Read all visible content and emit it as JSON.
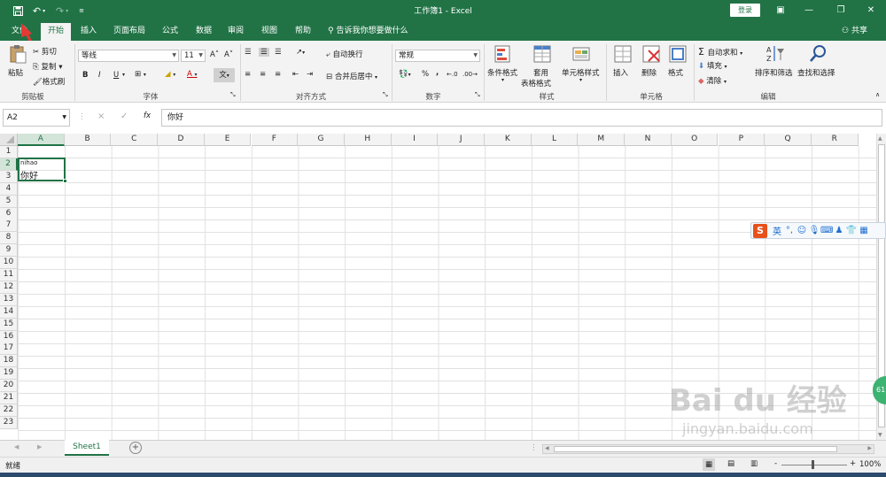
{
  "window": {
    "title": "工作簿1  -  Excel",
    "login_label": "登录",
    "share_label": "共享",
    "tell_me": "告诉我你想要做什么"
  },
  "tabs": [
    "文件",
    "开始",
    "插入",
    "页面布局",
    "公式",
    "数据",
    "审阅",
    "视图",
    "帮助"
  ],
  "active_tab": "开始",
  "clipboard": {
    "paste": "粘贴",
    "cut": "剪切",
    "copy": "复制",
    "format_painter": "格式刷",
    "group": "剪贴板"
  },
  "font": {
    "name": "等线",
    "size": "11",
    "group": "字体",
    "bold": "B",
    "italic": "I",
    "underline": "U"
  },
  "alignment": {
    "wrap": "自动换行",
    "merge": "合并后居中",
    "group": "对齐方式"
  },
  "number": {
    "format": "常规",
    "percent": "%",
    "comma": ",",
    "group": "数字"
  },
  "styles": {
    "conditional": "条件格式",
    "table_line1": "套用",
    "table_line2": "表格格式",
    "cell_styles": "单元格样式",
    "group": "样式"
  },
  "cells_group": {
    "insert": "插入",
    "delete": "删除",
    "format": "格式",
    "group": "单元格"
  },
  "editing": {
    "autosum": "自动求和",
    "fill": "填充",
    "clear": "清除",
    "sort": "排序和筛选",
    "find": "查找和选择",
    "group": "编辑"
  },
  "formula_bar": {
    "name_box": "A2",
    "cancel": "×",
    "enter": "✓",
    "fx": "fx",
    "content": "你好"
  },
  "columns": [
    "A",
    "B",
    "C",
    "D",
    "E",
    "F",
    "G",
    "H",
    "I",
    "J",
    "K",
    "L",
    "M",
    "N",
    "O",
    "P",
    "Q",
    "R"
  ],
  "rows": [
    "1",
    "2",
    "3",
    "4",
    "5",
    "6",
    "7",
    "8",
    "9",
    "10",
    "11",
    "12",
    "13",
    "14",
    "15",
    "16",
    "17",
    "18",
    "19",
    "20",
    "21",
    "22",
    "23"
  ],
  "cell_a2": {
    "phonetic": "nihao",
    "text": "你好"
  },
  "sheet": {
    "tab": "Sheet1",
    "add": "+"
  },
  "status": {
    "mode": "就绪",
    "zoom": "100%",
    "minus": "-",
    "plus": "+"
  },
  "ime": {
    "lang": "英"
  },
  "watermark": {
    "logo": "Bai du 经验",
    "url": "jingyan.baidu.com"
  },
  "side_badge": "61",
  "colors": {
    "excel_green": "#217346",
    "selection": "#d3e4d8"
  }
}
